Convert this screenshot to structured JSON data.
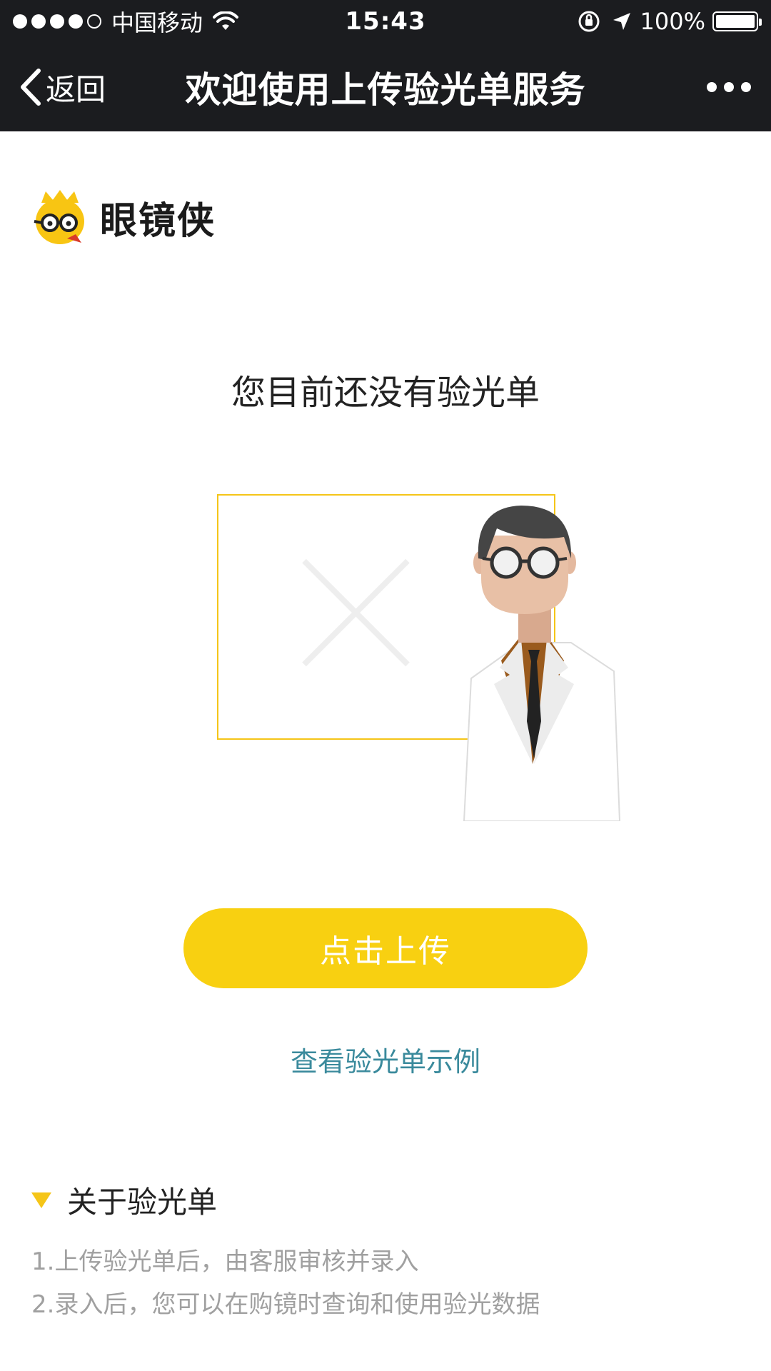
{
  "status_bar": {
    "carrier": "中国移动",
    "time": "15:43",
    "battery": "100%",
    "battery_level": 1.0
  },
  "nav": {
    "back_label": "返回",
    "title": "欢迎使用上传验光单服务"
  },
  "brand": {
    "name": "眼镜侠"
  },
  "empty_state": {
    "message": "您目前还没有验光单"
  },
  "actions": {
    "upload_label": "点击上传",
    "example_link": "查看验光单示例"
  },
  "about": {
    "title": "关于验光单",
    "items": [
      "1.上传验光单后，由客服审核并录入",
      "2.录入后，您可以在购镜时查询和使用验光数据"
    ]
  },
  "colors": {
    "accent": "#f8d011",
    "link": "#3a8a9c",
    "bar": "#1b1c1f"
  },
  "icons": [
    "wifi-icon",
    "orientation-lock-icon",
    "location-arrow-icon",
    "chevron-left-icon",
    "more-icon",
    "triangle-down-icon"
  ]
}
